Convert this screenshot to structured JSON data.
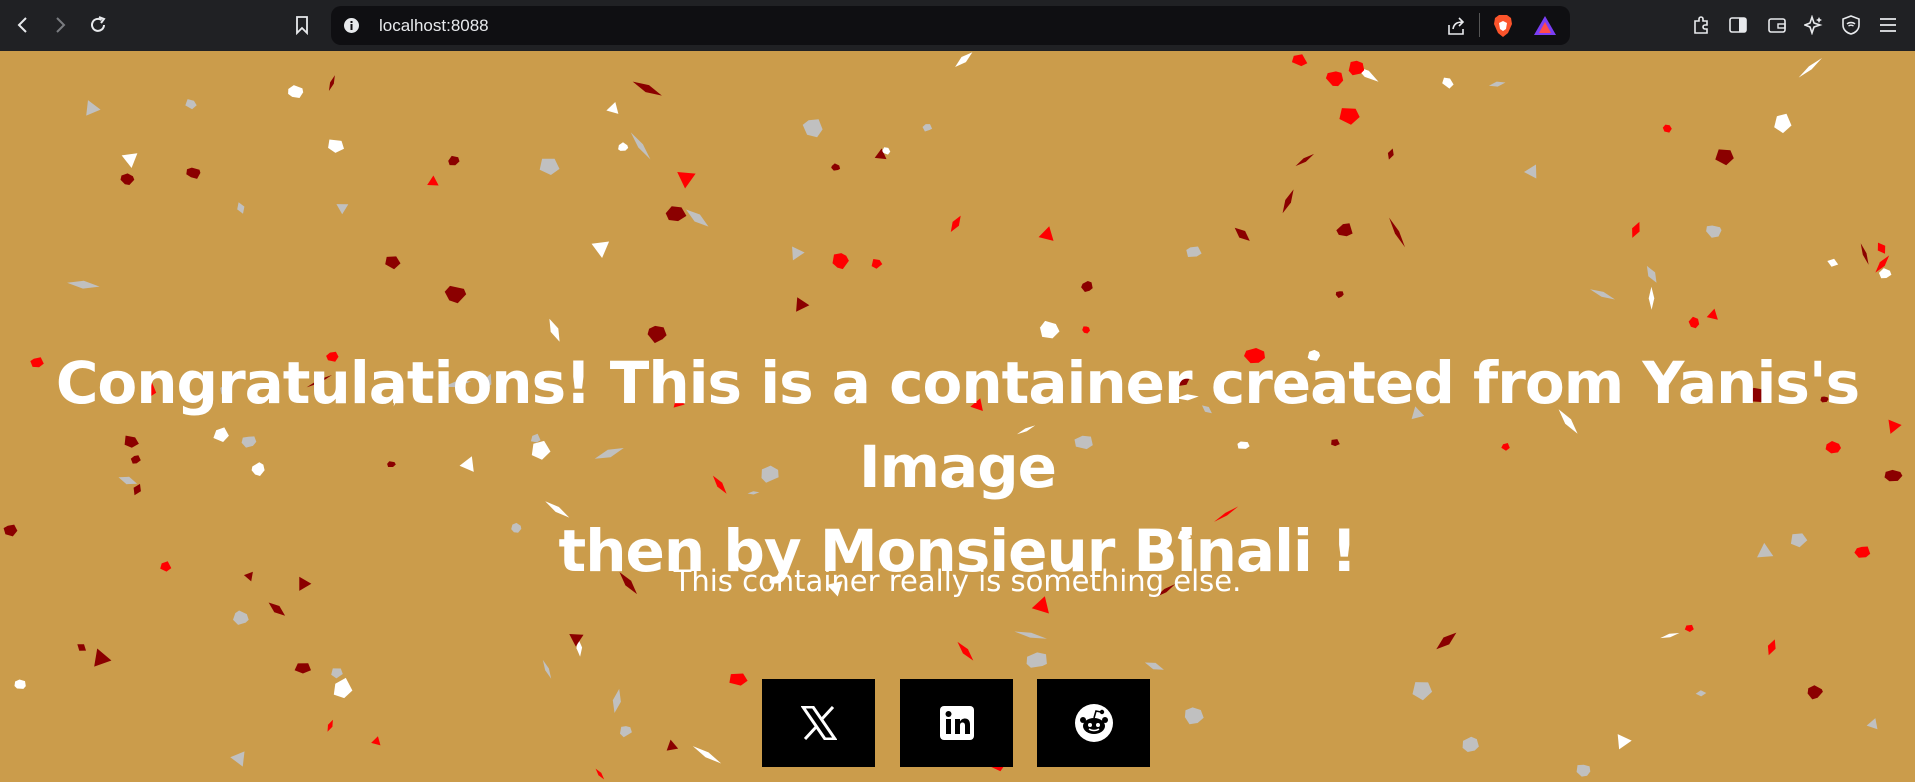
{
  "browser": {
    "url": "localhost:8088",
    "icons": [
      "back-icon",
      "forward-icon",
      "reload-icon",
      "bookmark-icon",
      "site-info-icon",
      "share-icon",
      "brave-shields-icon",
      "brave-rewards-icon",
      "extensions-icon",
      "sidebar-icon",
      "wallet-icon",
      "leo-ai-icon",
      "vpn-icon",
      "menu-icon"
    ]
  },
  "hero": {
    "title_line1": "Congratulations! This is a container created from Yanis's Image",
    "title_line2": "then by Monsieur Binali !",
    "subtitle": "This container really is something else."
  },
  "share": {
    "buttons": [
      "x-icon",
      "linkedin-icon",
      "reddit-icon"
    ]
  },
  "colors": {
    "background": "#cb9c4b",
    "text": "#ffffff",
    "button": "#000000",
    "confetti": [
      "#ffffff",
      "#c0c0c0",
      "#ff0000",
      "#8b0000"
    ]
  }
}
